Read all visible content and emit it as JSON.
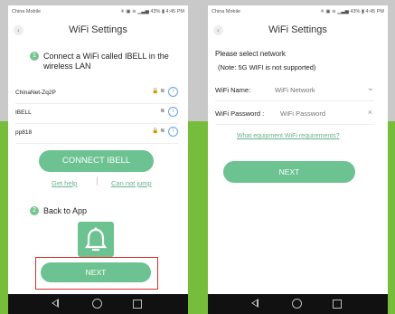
{
  "left": {
    "status": {
      "carrier": "China Mobile",
      "right": "✳ ▣ ≋ ▁▃▅ 43% ▮ 4:45 PM"
    },
    "title": "WiFi Settings",
    "step1": {
      "number": "1",
      "text": "Connect a WiFi called IBELL in the wireless LAN"
    },
    "networks": [
      {
        "name": "ChinaNet-Zq2P",
        "icons": "🔒 ≋"
      },
      {
        "name": "IBELL",
        "icons": "≋"
      },
      {
        "name": "pp818",
        "icons": "🔒 ≋"
      }
    ],
    "info_glyph": "i",
    "connect_label": "CONNECT IBELL",
    "get_help": "Get help",
    "cannot_jump": "Can not jump",
    "step2": {
      "number": "2",
      "text": "Back to App"
    },
    "next_label": "NEXT"
  },
  "right": {
    "status": {
      "carrier": "China Mobile",
      "right": "✳ ▣ ≋ ▁▃▅ 43% ▮ 4:45 PM"
    },
    "title": "WiFi Settings",
    "select_text": "Please select network",
    "note_text": "(Note: 5G WIFI is not supported)",
    "wifi_name_label": "WiFi Name:",
    "wifi_name_placeholder": "WiFi Network",
    "wifi_password_label": "WiFi Password :",
    "wifi_password_placeholder": "WiFi Password",
    "requirements_link": "What equipment WiFi requirements?",
    "next_label": "NEXT"
  },
  "icons": {
    "back": "back-arrow-icon",
    "bell": "bell-icon",
    "chevron": "chevron-down-icon",
    "clear": "close-icon"
  },
  "colors": {
    "accent": "#6cc291",
    "highlight": "#d9312b",
    "bg_gray": "#c9c9c9",
    "bg_green": "#77bd3c"
  }
}
